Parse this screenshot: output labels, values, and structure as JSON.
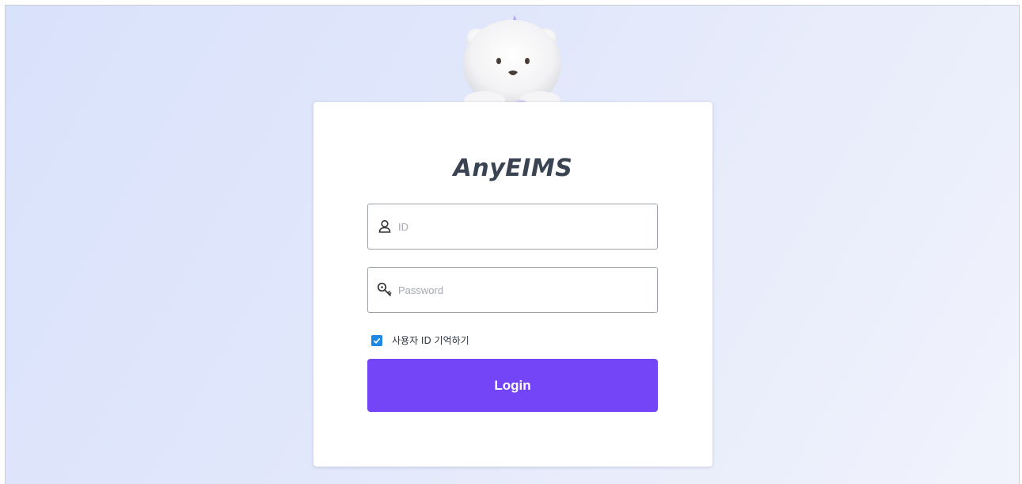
{
  "brand": {
    "title": "AnyEIMS"
  },
  "form": {
    "id_placeholder": "ID",
    "id_value": "",
    "password_placeholder": "Password",
    "password_value": "",
    "remember_label": "사용자 ID 기억하기",
    "remember_checked": true,
    "login_label": "Login"
  },
  "colors": {
    "primary_button": "#7444f7",
    "checkbox": "#1e88e5",
    "brand_text": "#3a4352"
  },
  "icons": {
    "id_field": "user-icon",
    "password_field": "key-icon",
    "mascot": "polar-bear-mascot"
  }
}
